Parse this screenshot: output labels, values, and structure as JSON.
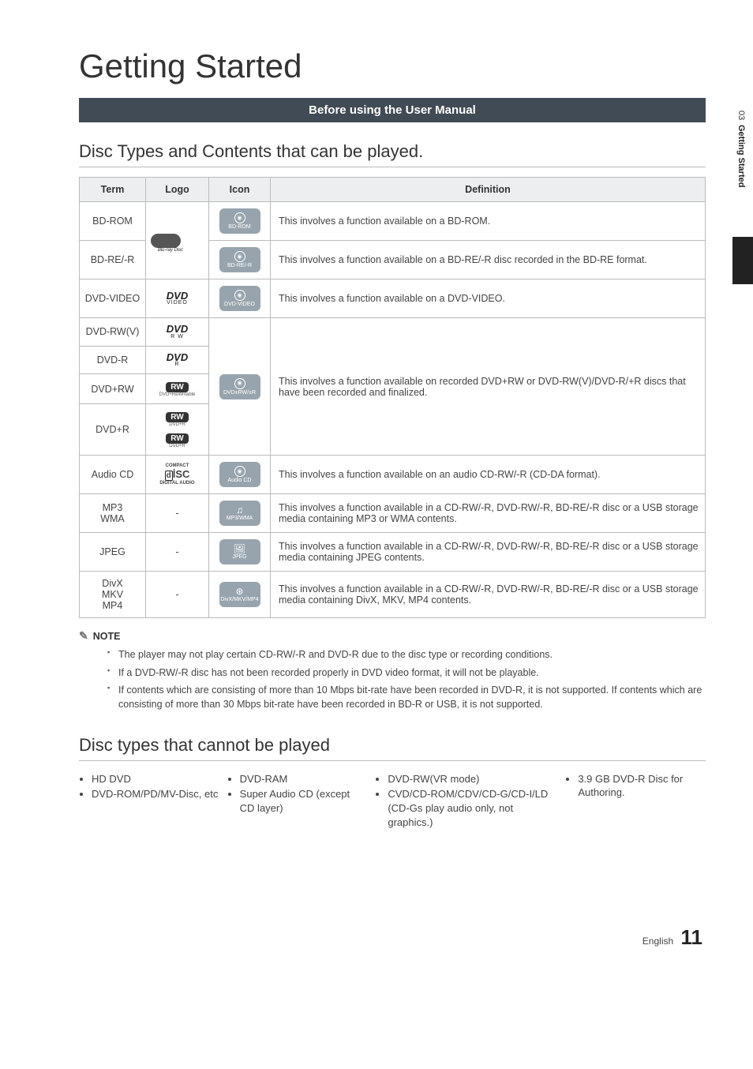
{
  "sidebar": {
    "chapter_num": "03",
    "chapter_name": "Getting Started"
  },
  "page_title": "Getting Started",
  "section_bar": "Before using the User Manual",
  "heading1": "Disc Types and Contents that can be played.",
  "table": {
    "headers": {
      "term": "Term",
      "logo": "Logo",
      "icon": "Icon",
      "definition": "Definition"
    },
    "rows": [
      {
        "term": "BD-ROM",
        "icon_label": "BD-ROM",
        "icon_glyph": "disc",
        "definition": "This involves a function available on a BD-ROM."
      },
      {
        "term": "BD-RE/-R",
        "icon_label": "BD-RE/-R",
        "icon_glyph": "disc",
        "definition": "This involves a function available on a BD-RE/-R disc recorded in the BD-RE format."
      },
      {
        "term": "DVD-VIDEO",
        "icon_label": "DVD-VIDEO",
        "icon_glyph": "disc",
        "definition": "This involves a function available on a DVD-VIDEO."
      },
      {
        "term": "DVD-RW(V)",
        "icon_label": "DVD±RW/±R",
        "icon_glyph": "disc",
        "definition": "This involves a function available on recorded DVD+RW or DVD-RW(V)/DVD-R/+R discs that have been recorded and finalized."
      },
      {
        "term": "DVD-R"
      },
      {
        "term": "DVD+RW"
      },
      {
        "term": "DVD+R"
      },
      {
        "term": "Audio CD",
        "icon_label": "Audio CD",
        "icon_glyph": "disc",
        "definition": "This involves a function available on an audio CD-RW/-R (CD-DA format)."
      },
      {
        "term": "MP3\nWMA",
        "logo_dash": "-",
        "icon_label": "MP3/WMA",
        "icon_glyph": "music",
        "definition": "This involves a function available in a CD-RW/-R, DVD-RW/-R, BD-RE/-R disc or a USB storage media containing MP3 or WMA contents."
      },
      {
        "term": "JPEG",
        "logo_dash": "-",
        "icon_label": "JPEG",
        "icon_glyph": "photo",
        "definition": "This involves a function available in a CD-RW/-R, DVD-RW/-R, BD-RE/-R disc or a USB storage media containing JPEG contents."
      },
      {
        "term": "DivX\nMKV\nMP4",
        "logo_dash": "-",
        "icon_label": "DivX/MKV/MP4",
        "icon_glyph": "video",
        "definition": "This involves a function available in a CD-RW/-R, DVD-RW/-R, BD-RE/-R disc or a USB storage media containing DivX, MKV, MP4 contents."
      }
    ],
    "logos": {
      "bluray": "Blu-ray Disc",
      "dvd_video": {
        "main": "DVD",
        "sub": "VIDEO"
      },
      "dvd_rw": {
        "main": "DVD",
        "sub": "R W"
      },
      "dvd_r": {
        "main": "DVD",
        "sub": "R"
      },
      "rw_plus": "RW",
      "rw_plus_sub1": "DVD+ReWritable",
      "rw_plus_sub2": "DVD+R",
      "rw_plus_sub3": "DVD+R",
      "cd": {
        "top": "COMPACT",
        "main": "disc",
        "sub": "DIGITAL AUDIO"
      }
    }
  },
  "note": {
    "label": "NOTE",
    "items": [
      "The player may not play certain CD-RW/-R and DVD-R due to the disc type or recording conditions.",
      "If a DVD-RW/-R disc has not been recorded properly in DVD video format, it will not be playable.",
      "If contents which are consisting of more than 10 Mbps bit-rate have been recorded in DVD-R, it is not supported. If contents which are consisting of more than 30 Mbps bit-rate have been recorded in BD-R or USB, it is not supported."
    ]
  },
  "heading2": "Disc types that cannot be played",
  "cannot": {
    "col1": [
      "HD DVD",
      "DVD-ROM/PD/MV-Disc, etc"
    ],
    "col2": [
      "DVD-RAM",
      "Super Audio CD (except CD layer)"
    ],
    "col3": [
      "DVD-RW(VR mode)",
      "CVD/CD-ROM/CDV/CD-G/CD-I/LD (CD-Gs play audio only, not graphics.)"
    ],
    "col4": [
      "3.9 GB DVD-R Disc for Authoring."
    ]
  },
  "footer": {
    "lang": "English",
    "page": "11"
  }
}
